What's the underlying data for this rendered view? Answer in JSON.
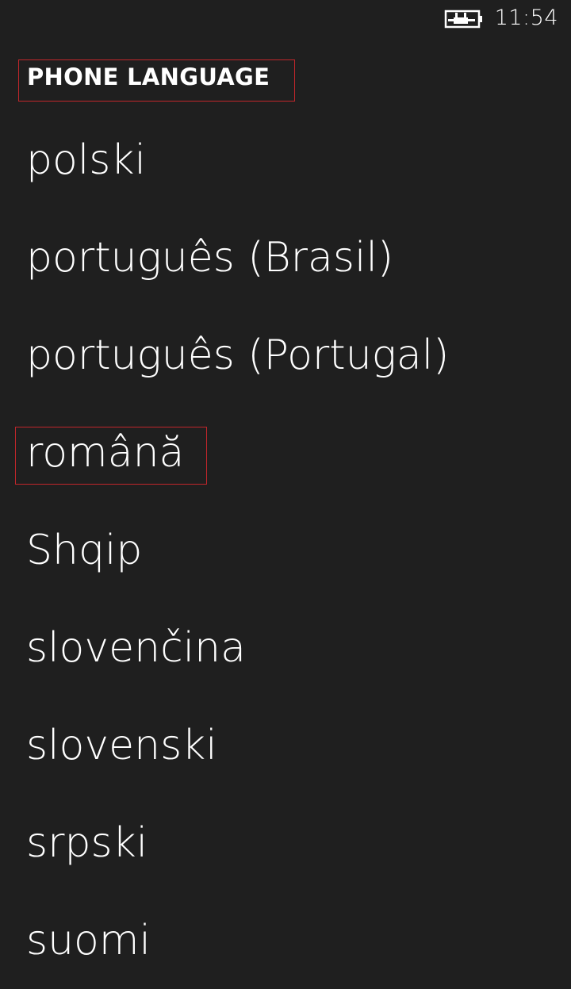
{
  "status_bar": {
    "time": "11:54",
    "battery_icon": "battery-charging-icon"
  },
  "page": {
    "title": "PHONE LANGUAGE"
  },
  "languages": [
    {
      "label": "polski"
    },
    {
      "label": "português (Brasil)"
    },
    {
      "label": "português (Portugal)"
    },
    {
      "label": "română"
    },
    {
      "label": "Shqip"
    },
    {
      "label": "slovenčina"
    },
    {
      "label": "slovenski"
    },
    {
      "label": "srpski"
    },
    {
      "label": "suomi"
    }
  ],
  "colors": {
    "background": "#1f1f1f",
    "text": "#ffffff",
    "highlight_border": "#c0262b"
  }
}
